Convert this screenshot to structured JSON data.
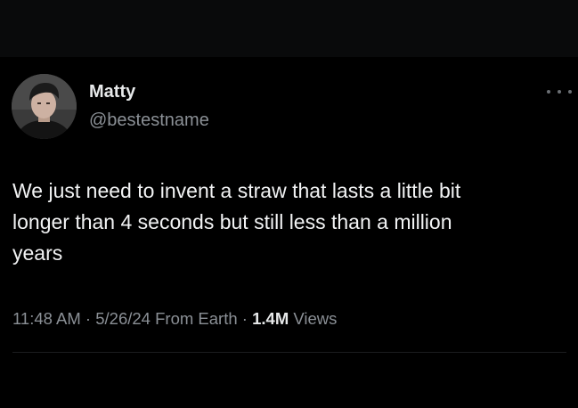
{
  "author": {
    "name": "Matty",
    "handle": "@bestestname"
  },
  "tweet": {
    "line1": "We just need to invent a straw that lasts a little bit",
    "line2": "longer than 4 seconds but still less than a million",
    "line3": "years"
  },
  "meta": {
    "time": "11:48 AM",
    "sep1": " · ",
    "date": "5/26/24",
    "source": " From Earth",
    "sep2": " · ",
    "views_count": "1.4M",
    "views_label": " Views"
  },
  "icons": {
    "more": "more-horizontal-icon",
    "avatar": "profile-photo"
  },
  "colors": {
    "background": "#000000",
    "primary_text": "#e7e9ea",
    "secondary_text": "#8b9096"
  }
}
